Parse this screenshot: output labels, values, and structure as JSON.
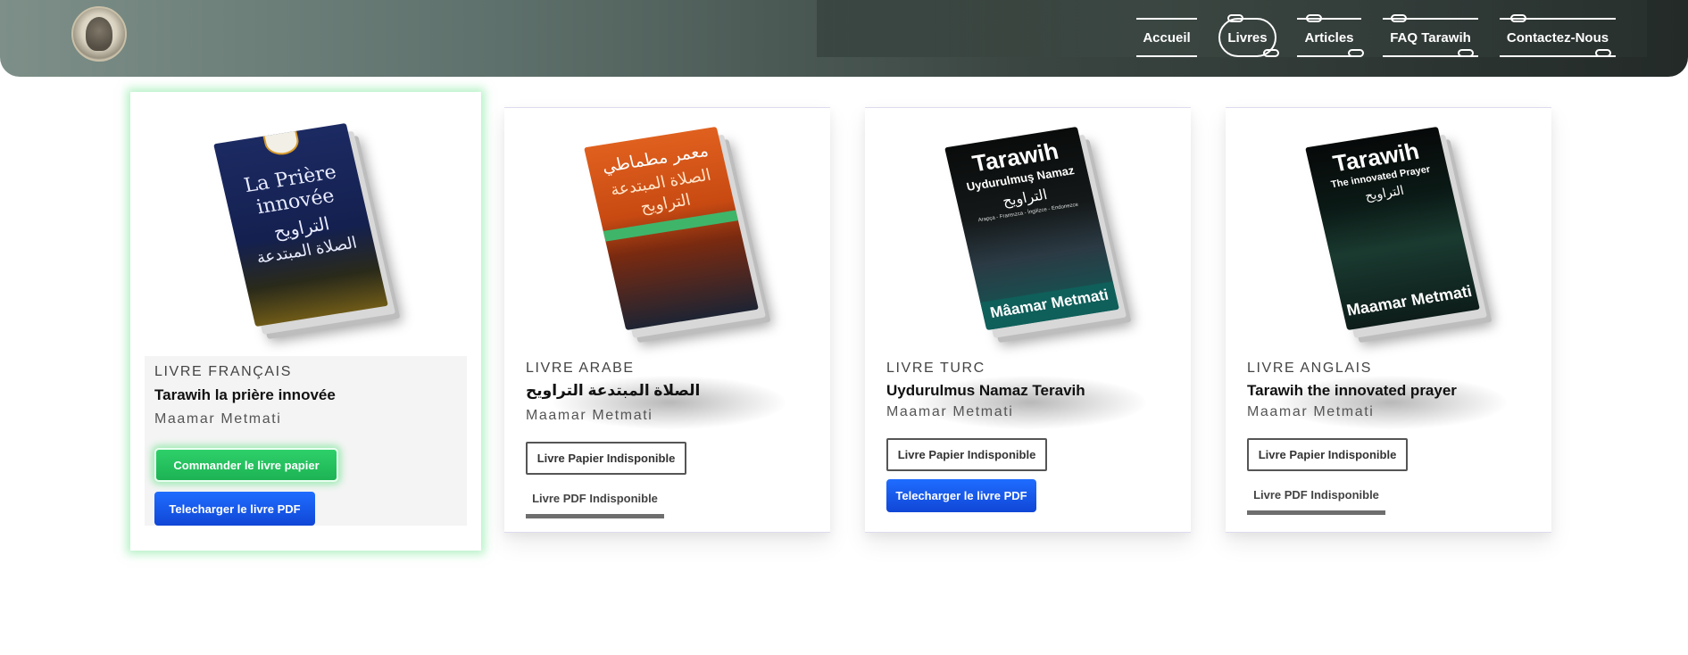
{
  "colors": {
    "header_start": "#7d8f88",
    "header_end": "#232a28",
    "green_button": "#1db354",
    "blue_button": "#1046d6",
    "featured_glow": "#78e696"
  },
  "header": {
    "logo_icon": "mosque-seal-logo",
    "nav": [
      {
        "label": "Accueil",
        "active": false
      },
      {
        "label": "Livres",
        "active": true
      },
      {
        "label": "Articles",
        "active": false
      },
      {
        "label": "FAQ Tarawih",
        "active": false
      },
      {
        "label": "Contactez-Nous",
        "active": false
      }
    ]
  },
  "books": [
    {
      "category": "LIVRE FRANÇAIS",
      "title": "Tarawih la prière innovée",
      "author": "Maamar Metmati",
      "cover_text": [
        "La Prière",
        "innovée",
        "التراويح",
        "الصلاة المبتدعة"
      ],
      "paper_button": "Commander le livre papier",
      "pdf_button": "Telecharger le livre PDF"
    },
    {
      "category": "LIVRE ARABE",
      "title": "الصلاة المبتدعة التراويح",
      "author": "Maamar Metmati",
      "cover_text": [
        "معمر مطماطي",
        "الصلاة المبتدعة",
        "التراويح"
      ],
      "paper_button": "Livre Papier Indisponible",
      "pdf_button": "Livre PDF Indisponible"
    },
    {
      "category": "LIVRE TURC",
      "title": "Uydurulmus Namaz Teravih",
      "author": "Maamar Metmati",
      "cover_text": [
        "Tarawih",
        "Uydurulmuş Namaz",
        "التراويح",
        "Arapça - Fransızca - İngilizce - Endonezce",
        "Mâamar Metmati"
      ],
      "paper_button": "Livre Papier Indisponible",
      "pdf_button": "Telecharger le livre PDF"
    },
    {
      "category": "LIVRE ANGLAIS",
      "title": "Tarawih the innovated prayer",
      "author": "Maamar Metmati",
      "cover_text": [
        "Tarawih",
        "The innovated Prayer",
        "التراويح",
        "Maamar Metmati"
      ],
      "paper_button": "Livre Papier Indisponible",
      "pdf_button": "Livre PDF Indisponible"
    }
  ]
}
